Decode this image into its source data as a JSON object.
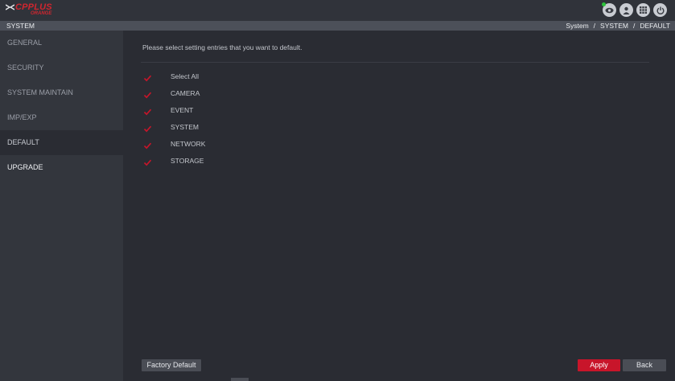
{
  "app": {
    "logo_main": "CPPLUS",
    "logo_sub": "ORANGE"
  },
  "header": {
    "title": "SYSTEM",
    "breadcrumb": [
      "System",
      "SYSTEM",
      "DEFAULT"
    ],
    "breadcrumb_separator": "/"
  },
  "top_icons": [
    {
      "name": "live-view-icon"
    },
    {
      "name": "user-icon"
    },
    {
      "name": "grid-menu-icon"
    },
    {
      "name": "power-icon"
    }
  ],
  "sidebar": {
    "items": [
      {
        "label": "GENERAL"
      },
      {
        "label": "SECURITY"
      },
      {
        "label": "SYSTEM MAINTAIN"
      },
      {
        "label": "IMP/EXP"
      },
      {
        "label": "DEFAULT"
      },
      {
        "label": "UPGRADE"
      }
    ],
    "active": "DEFAULT"
  },
  "main": {
    "instruction": "Please select setting entries that you want to default.",
    "options": [
      {
        "label": "Select All",
        "checked": true
      },
      {
        "label": "CAMERA",
        "checked": true
      },
      {
        "label": "EVENT",
        "checked": true
      },
      {
        "label": "SYSTEM",
        "checked": true
      },
      {
        "label": "NETWORK",
        "checked": true
      },
      {
        "label": "STORAGE",
        "checked": true
      }
    ]
  },
  "buttons": {
    "factory_default": "Factory Default",
    "apply": "Apply",
    "back": "Back"
  },
  "colors": {
    "accent": "#c8152a",
    "check": "#c8152a",
    "status_online": "#2cc23a"
  }
}
